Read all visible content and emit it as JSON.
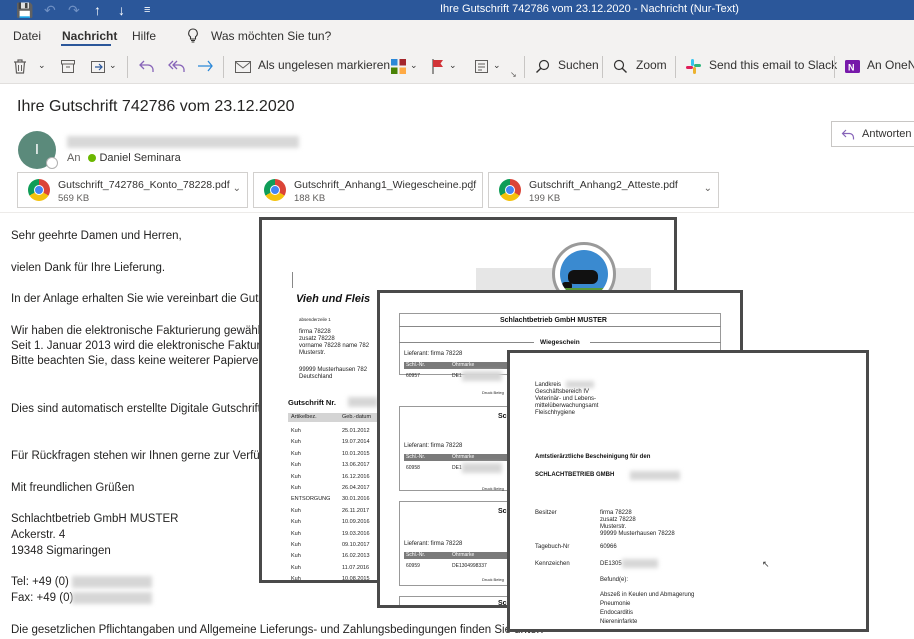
{
  "window": {
    "title": "Ihre Gutschrift 742786 vom 23.12.2020  -  Nachricht (Nur-Text)"
  },
  "quick_access": {
    "save": "💾",
    "undo": "↶",
    "redo": "↷",
    "up": "↑",
    "down": "↓",
    "customize": "≡"
  },
  "menu": {
    "items": [
      "Datei",
      "Nachricht",
      "Hilfe"
    ],
    "search_placeholder": "Was möchten Sie tun?"
  },
  "ribbon": {
    "mark_unread": "Als ungelesen markieren",
    "search": "Suchen",
    "zoom": "Zoom",
    "slack": "Send this email to Slack",
    "onenote": "An OneNo"
  },
  "email": {
    "subject": "Ihre Gutschrift 742786 vom 23.12.2020",
    "avatar_initial": "I",
    "to_label": "An",
    "recipient": "Daniel Seminara",
    "reply": "Antworten",
    "attachments": [
      {
        "name": "Gutschrift_742786_Konto_78228.pdf",
        "size": "569 KB"
      },
      {
        "name": "Gutschrift_Anhang1_Wiegescheine.pdf",
        "size": "188 KB"
      },
      {
        "name": "Gutschrift_Anhang2_Atteste.pdf",
        "size": "199 KB"
      }
    ],
    "body": {
      "salutation": "Sehr geehrte Damen und Herren,",
      "thanks": "vielen Dank für Ihre Lieferung.",
      "attachment_note": "In der Anlage erhalten Sie wie vereinbart die Guts",
      "einvoice_1": "Wir haben die elektronische Fakturierung gewählt",
      "einvoice_2": "Seit 1. Januar 2013 wird die elektronische Fakturie",
      "einvoice_3": "Bitte beachten Sie, dass keine weiterer Papiervers",
      "automatic": "Dies sind automatisch erstellte Digitale Gutschrifte",
      "questions": "Für Rückfragen stehen wir Ihnen gerne zur Verfüg",
      "regards": "Mit freundlichen Grüßen",
      "company": "Schlachtbetrieb GmbH MUSTER",
      "street": "Ackerstr. 4",
      "city": "19348 Sigmaringen",
      "tel": "Tel: +49 (0)",
      "fax": "Fax: +49 (0)",
      "footer": "Die gesetzlichen Pflichtangaben und Allgemeine Lieferungs- und Zahlungsbedingungen finden Sie unter:"
    }
  },
  "doc1": {
    "title": "Vieh und Fleis",
    "addr": [
      "absenderzeile 1",
      "firma 78228",
      "zusatz 78228",
      "vorname 78228 name 782",
      "Musterstr.",
      "",
      "99999 Musterhausen 782",
      "Deutschland"
    ],
    "gutschrift": "Gutschrift Nr.",
    "col_headers": [
      "Artikelbez.",
      "Geb.-datum"
    ],
    "rows": [
      [
        "Kuh",
        "25.01.2012"
      ],
      [
        "Kuh",
        "19.07.2014"
      ],
      [
        "Kuh",
        "10.01.2015"
      ],
      [
        "Kuh",
        "13.06.2017"
      ],
      [
        "Kuh",
        "16.12.2016"
      ],
      [
        "Kuh",
        "26.04.2017"
      ],
      [
        "ENTSORGUNG",
        "30.01.2016"
      ],
      [
        "Kuh",
        "26.11.2017"
      ],
      [
        "Kuh",
        "10.09.2016"
      ],
      [
        "Kuh",
        "19.03.2016"
      ],
      [
        "Kuh",
        "09.10.2017"
      ],
      [
        "Kuh",
        "16.02.2013"
      ],
      [
        "Kuh",
        "11.07.2016"
      ],
      [
        "Kuh",
        "10.08.2015"
      ]
    ]
  },
  "doc2": {
    "header": "Schlachtbetrieb GmbH MUSTER",
    "subheader": "Wiegeschein",
    "lieferant": "Lieferant: firma 78228",
    "col_schl": "Schl.-Nr.",
    "col_ohr": "Ohrmarke",
    "sections": [
      {
        "nr": "60957",
        "ohr": "DE1"
      },
      {
        "nr": "60958",
        "ohr": "DE1"
      },
      {
        "nr": "60959",
        "ohr": "DE1304998337"
      }
    ],
    "druck": "Druck Beleg",
    "sch": "Sch"
  },
  "doc3": {
    "issuer": [
      "Landkreis",
      "Geschäftsbereich IV",
      "Veterinär- und Lebens-",
      "mittelüberwachungsamt",
      "Fleischhygiene"
    ],
    "title": "Amtstierärztliche Bescheinigung für den",
    "firm": "SCHLACHTBETRIEB GMBH",
    "besitzer_label": "Besitzer",
    "besitzer": [
      "firma 78228",
      "zusatz 78228",
      "Musterstr.",
      "99999 Musterhausen 78228"
    ],
    "tagebuch_label": "Tagebuch-Nr",
    "tagebuch": "60966",
    "kennzeichen_label": "Kennzeichen",
    "kennzeichen": "DE1305",
    "befund_label": "Befund(e):",
    "befunde": [
      "Abszeß in Keulen und Abmagerung",
      "Pneumonie",
      "Endocarditis",
      "Niereninfarkte"
    ]
  }
}
